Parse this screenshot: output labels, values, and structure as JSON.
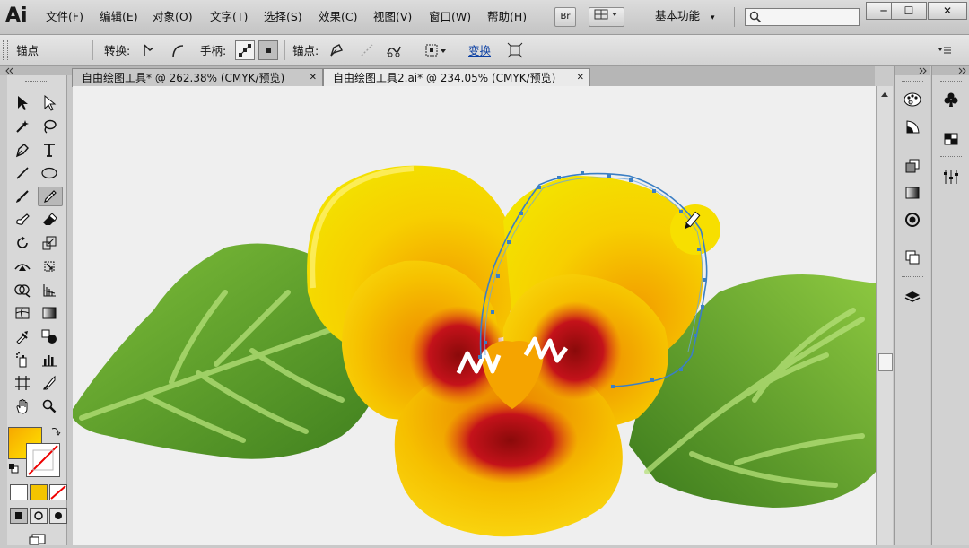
{
  "app": {
    "logo": "Ai"
  },
  "menu": [
    "文件(F)",
    "编辑(E)",
    "对象(O)",
    "文字(T)",
    "选择(S)",
    "效果(C)",
    "视图(V)",
    "窗口(W)",
    "帮助(H)"
  ],
  "menubar_buttons": {
    "bridge": "Br"
  },
  "workspace": {
    "label": "基本功能",
    "arrow": "▾"
  },
  "window_controls": {
    "minimize": "─",
    "maximize": "☐",
    "close": "✕"
  },
  "control_bar": {
    "tool_name": "锚点",
    "convert_label": "转换:",
    "handles_label": "手柄:",
    "anchor_label": "锚点:",
    "transform_link": "变换"
  },
  "tabs": [
    {
      "title": "自由绘图工具* @ 262.38% (CMYK/预览)",
      "close": "✕",
      "active": false
    },
    {
      "title": "自由绘图工具2.ai* @ 234.05% (CMYK/预览)",
      "close": "✕",
      "active": true
    }
  ],
  "tools": [
    "selection-tool",
    "direct-selection-tool",
    "magic-wand-tool",
    "lasso-tool",
    "pen-tool",
    "type-tool",
    "line-tool",
    "ellipse-tool",
    "paintbrush-tool",
    "pencil-tool",
    "blob-brush-tool",
    "eraser-tool",
    "rotate-tool",
    "scale-tool",
    "width-tool",
    "free-transform-tool",
    "shape-builder-tool",
    "perspective-grid-tool",
    "mesh-tool",
    "gradient-tool",
    "eyedropper-tool",
    "blend-tool",
    "symbol-sprayer-tool",
    "column-graph-tool",
    "artboard-tool",
    "slice-tool",
    "hand-tool",
    "zoom-tool"
  ],
  "active_tool": "pencil-tool",
  "colors": {
    "fill_gradient_start": "#f7a800",
    "fill_gradient_end": "#ffe600",
    "selection_path": "#3b7fc4",
    "petal_yellow": "#f5d000",
    "leaf_green": "#5a9a2a",
    "center_red": "#c0101a"
  }
}
